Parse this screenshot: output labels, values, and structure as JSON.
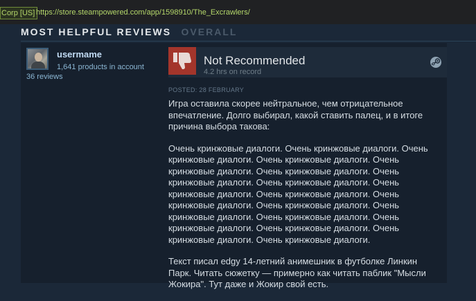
{
  "browser": {
    "cert_label": "Corp [US]",
    "url": "https://store.steampowered.com/app/1598910/The_Excrawlers/"
  },
  "section": {
    "title": "MOST HELPFUL REVIEWS",
    "tab_overall": "OVERALL"
  },
  "review": {
    "author": {
      "name": "usermame",
      "products": "1,641 products in account",
      "reviews": "36 reviews"
    },
    "verdict": "Not Recommended",
    "hours": "4.2 hrs on record",
    "posted": "POSTED: 28 FEBRUARY",
    "paragraphs": [
      "Игра оставила скорее нейтральное, чем отрицательное впечатление. Долго выбирал, какой ставить палец, и в итоге причина выбора такова:",
      "Очень кринжовые диалоги. Очень кринжовые диалоги. Очень кринжовые диалоги. Очень кринжовые диалоги. Очень кринжовые диалоги. Очень кринжовые диалоги. Очень кринжовые диалоги. Очень кринжовые диалоги. Очень кринжовые диалоги. Очень кринжовые диалоги. Очень кринжовые диалоги. Очень кринжовые диалоги. Очень кринжовые диалоги. Очень кринжовые диалоги. Очень кринжовые диалоги. Очень кринжовые диалоги. Очень кринжовые диалоги. Очень кринжовые диалоги.",
      "Текст писал edgy 14-летний анимешник в футболке Линкин Парк. Читать сюжетку — примерно как читать паблик \"Мысли Жокира\". Тут даже и Жокир свой есть."
    ],
    "icons": {
      "vote": "thumbs-down-icon",
      "platform": "steam-icon"
    },
    "colors": {
      "not_recommended": "#a3352b",
      "background": "#1b2838",
      "card": "#16202d"
    }
  }
}
